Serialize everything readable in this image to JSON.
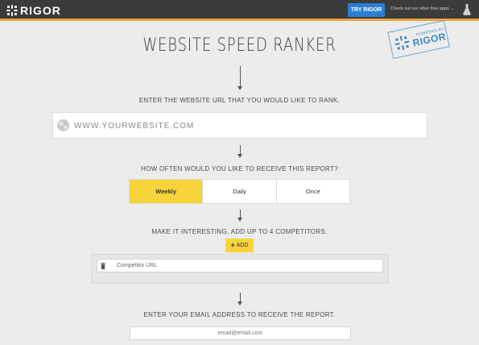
{
  "header": {
    "logo_text": "RIGOR",
    "try_button": "TRY RIGOR",
    "other_apps": "Check out our other free apps →",
    "accent_color": "#e8a33a",
    "button_color": "#2a7fd4"
  },
  "stamp": {
    "powered": "POWERED BY",
    "brand": "RIGOR"
  },
  "page_title": "WEBSITE SPEED RANKER",
  "step1": {
    "label": "ENTER THE WEBSITE URL THAT YOU WOULD LIKE TO RANK.",
    "placeholder": "WWW.YOURWEBSITE.COM"
  },
  "step2": {
    "label": "HOW OFTEN WOULD YOU LIKE TO RECEIVE THIS REPORT?",
    "options": [
      "Weekly",
      "Daily",
      "Once"
    ],
    "selected": "Weekly",
    "active_color": "#f7d43a"
  },
  "step3": {
    "label": "MAKE IT INTERESTING, ADD UP TO 4 COMPETITORS.",
    "add_label": "ADD",
    "competitor_placeholder": "Competitor URL"
  },
  "step4": {
    "label": "ENTER YOUR EMAIL ADDRESS TO RECEIVE THE REPORT.",
    "email_placeholder": "email@email.com"
  }
}
